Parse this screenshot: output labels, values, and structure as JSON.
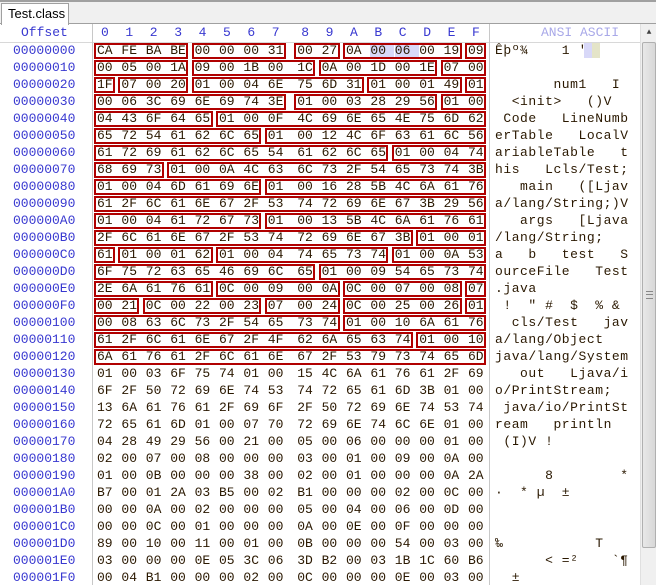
{
  "tab": {
    "label": "Test.class"
  },
  "header": {
    "offset_label": "Offset",
    "columns": [
      "0",
      "1",
      "2",
      "3",
      "4",
      "5",
      "6",
      "7",
      "8",
      "9",
      "A",
      "B",
      "C",
      "D",
      "E",
      "F"
    ],
    "ascii_label": "ANSI ASCII"
  },
  "selection": {
    "row": 0,
    "bytes": [
      11,
      12
    ]
  },
  "highlight_color": "#b00000",
  "rows": [
    {
      "offset": "00000000",
      "hex": [
        "CA",
        "FE",
        "BA",
        "BE",
        "00",
        "00",
        "00",
        "31",
        "00",
        "27",
        "0A",
        "00",
        "06",
        "00",
        "19",
        "09"
      ],
      "ascii": "Êþº¾    1 '     ",
      "groups": [
        [
          0,
          3
        ],
        [
          4,
          7
        ],
        [
          8,
          9
        ],
        [
          10,
          14
        ],
        [
          15,
          15
        ]
      ]
    },
    {
      "offset": "00000010",
      "hex": [
        "00",
        "05",
        "00",
        "1A",
        "09",
        "00",
        "1B",
        "00",
        "1C",
        "0A",
        "00",
        "1D",
        "00",
        "1E",
        "07",
        "00"
      ],
      "ascii": "                ",
      "groups": [
        [
          0,
          3
        ],
        [
          4,
          8
        ],
        [
          9,
          13
        ],
        [
          14,
          15
        ]
      ]
    },
    {
      "offset": "00000020",
      "hex": [
        "1F",
        "07",
        "00",
        "20",
        "01",
        "00",
        "04",
        "6E",
        "75",
        "6D",
        "31",
        "01",
        "00",
        "01",
        "49",
        "01"
      ],
      "ascii": "       num1   I ",
      "groups": [
        [
          0,
          0
        ],
        [
          1,
          3
        ],
        [
          4,
          10
        ],
        [
          11,
          14
        ],
        [
          15,
          15
        ]
      ]
    },
    {
      "offset": "00000030",
      "hex": [
        "00",
        "06",
        "3C",
        "69",
        "6E",
        "69",
        "74",
        "3E",
        "01",
        "00",
        "03",
        "28",
        "29",
        "56",
        "01",
        "00"
      ],
      "ascii": "  <init>   ()V  ",
      "groups": [
        [
          0,
          7
        ],
        [
          8,
          13
        ],
        [
          14,
          15
        ]
      ]
    },
    {
      "offset": "00000040",
      "hex": [
        "04",
        "43",
        "6F",
        "64",
        "65",
        "01",
        "00",
        "0F",
        "4C",
        "69",
        "6E",
        "65",
        "4E",
        "75",
        "6D",
        "62"
      ],
      "ascii": " Code   LineNumb",
      "groups": [
        [
          0,
          4
        ],
        [
          5,
          15
        ]
      ]
    },
    {
      "offset": "00000050",
      "hex": [
        "65",
        "72",
        "54",
        "61",
        "62",
        "6C",
        "65",
        "01",
        "00",
        "12",
        "4C",
        "6F",
        "63",
        "61",
        "6C",
        "56"
      ],
      "ascii": "erTable   LocalV",
      "groups": [
        [
          0,
          6
        ],
        [
          7,
          15
        ]
      ]
    },
    {
      "offset": "00000060",
      "hex": [
        "61",
        "72",
        "69",
        "61",
        "62",
        "6C",
        "65",
        "54",
        "61",
        "62",
        "6C",
        "65",
        "01",
        "00",
        "04",
        "74"
      ],
      "ascii": "ariableTable   t",
      "groups": [
        [
          0,
          11
        ],
        [
          12,
          15
        ]
      ]
    },
    {
      "offset": "00000070",
      "hex": [
        "68",
        "69",
        "73",
        "01",
        "00",
        "0A",
        "4C",
        "63",
        "6C",
        "73",
        "2F",
        "54",
        "65",
        "73",
        "74",
        "3B"
      ],
      "ascii": "his   Lcls/Test;",
      "groups": [
        [
          0,
          2
        ],
        [
          3,
          15
        ]
      ]
    },
    {
      "offset": "00000080",
      "hex": [
        "01",
        "00",
        "04",
        "6D",
        "61",
        "69",
        "6E",
        "01",
        "00",
        "16",
        "28",
        "5B",
        "4C",
        "6A",
        "61",
        "76"
      ],
      "ascii": "   main   ([Ljav",
      "groups": [
        [
          0,
          6
        ],
        [
          7,
          15
        ]
      ]
    },
    {
      "offset": "00000090",
      "hex": [
        "61",
        "2F",
        "6C",
        "61",
        "6E",
        "67",
        "2F",
        "53",
        "74",
        "72",
        "69",
        "6E",
        "67",
        "3B",
        "29",
        "56"
      ],
      "ascii": "a/lang/String;)V",
      "groups": [
        [
          0,
          15
        ]
      ]
    },
    {
      "offset": "000000A0",
      "hex": [
        "01",
        "00",
        "04",
        "61",
        "72",
        "67",
        "73",
        "01",
        "00",
        "13",
        "5B",
        "4C",
        "6A",
        "61",
        "76",
        "61"
      ],
      "ascii": "   args   [Ljava",
      "groups": [
        [
          0,
          6
        ],
        [
          7,
          15
        ]
      ]
    },
    {
      "offset": "000000B0",
      "hex": [
        "2F",
        "6C",
        "61",
        "6E",
        "67",
        "2F",
        "53",
        "74",
        "72",
        "69",
        "6E",
        "67",
        "3B",
        "01",
        "00",
        "01"
      ],
      "ascii": "/lang/String;   ",
      "groups": [
        [
          0,
          12
        ],
        [
          13,
          15
        ]
      ]
    },
    {
      "offset": "000000C0",
      "hex": [
        "61",
        "01",
        "00",
        "01",
        "62",
        "01",
        "00",
        "04",
        "74",
        "65",
        "73",
        "74",
        "01",
        "00",
        "0A",
        "53"
      ],
      "ascii": "a   b   test   S",
      "groups": [
        [
          0,
          0
        ],
        [
          1,
          4
        ],
        [
          5,
          11
        ],
        [
          12,
          15
        ]
      ]
    },
    {
      "offset": "000000D0",
      "hex": [
        "6F",
        "75",
        "72",
        "63",
        "65",
        "46",
        "69",
        "6C",
        "65",
        "01",
        "00",
        "09",
        "54",
        "65",
        "73",
        "74"
      ],
      "ascii": "ourceFile   Test",
      "groups": [
        [
          0,
          8
        ],
        [
          9,
          15
        ]
      ]
    },
    {
      "offset": "000000E0",
      "hex": [
        "2E",
        "6A",
        "61",
        "76",
        "61",
        "0C",
        "00",
        "09",
        "00",
        "0A",
        "0C",
        "00",
        "07",
        "00",
        "08",
        "07"
      ],
      "ascii": ".java           ",
      "groups": [
        [
          0,
          4
        ],
        [
          5,
          9
        ],
        [
          10,
          14
        ],
        [
          15,
          15
        ]
      ]
    },
    {
      "offset": "000000F0",
      "hex": [
        "00",
        "21",
        "0C",
        "00",
        "22",
        "00",
        "23",
        "07",
        "00",
        "24",
        "0C",
        "00",
        "25",
        "00",
        "26",
        "01"
      ],
      "ascii": " !  \" #  $  % & ",
      "groups": [
        [
          0,
          1
        ],
        [
          2,
          6
        ],
        [
          7,
          9
        ],
        [
          10,
          14
        ],
        [
          15,
          15
        ]
      ]
    },
    {
      "offset": "00000100",
      "hex": [
        "00",
        "08",
        "63",
        "6C",
        "73",
        "2F",
        "54",
        "65",
        "73",
        "74",
        "01",
        "00",
        "10",
        "6A",
        "61",
        "76"
      ],
      "ascii": "  cls/Test   jav",
      "groups": [
        [
          0,
          9
        ],
        [
          10,
          15
        ]
      ]
    },
    {
      "offset": "00000110",
      "hex": [
        "61",
        "2F",
        "6C",
        "61",
        "6E",
        "67",
        "2F",
        "4F",
        "62",
        "6A",
        "65",
        "63",
        "74",
        "01",
        "00",
        "10"
      ],
      "ascii": "a/lang/Object   ",
      "groups": [
        [
          0,
          12
        ],
        [
          13,
          15
        ]
      ]
    },
    {
      "offset": "00000120",
      "hex": [
        "6A",
        "61",
        "76",
        "61",
        "2F",
        "6C",
        "61",
        "6E",
        "67",
        "2F",
        "53",
        "79",
        "73",
        "74",
        "65",
        "6D"
      ],
      "ascii": "java/lang/System",
      "groups": [
        [
          0,
          15
        ]
      ]
    },
    {
      "offset": "00000130",
      "hex": [
        "01",
        "00",
        "03",
        "6F",
        "75",
        "74",
        "01",
        "00",
        "15",
        "4C",
        "6A",
        "61",
        "76",
        "61",
        "2F",
        "69"
      ],
      "ascii": "   out   Ljava/i",
      "groups": []
    },
    {
      "offset": "00000140",
      "hex": [
        "6F",
        "2F",
        "50",
        "72",
        "69",
        "6E",
        "74",
        "53",
        "74",
        "72",
        "65",
        "61",
        "6D",
        "3B",
        "01",
        "00"
      ],
      "ascii": "o/PrintStream;  ",
      "groups": []
    },
    {
      "offset": "00000150",
      "hex": [
        "13",
        "6A",
        "61",
        "76",
        "61",
        "2F",
        "69",
        "6F",
        "2F",
        "50",
        "72",
        "69",
        "6E",
        "74",
        "53",
        "74"
      ],
      "ascii": " java/io/PrintSt",
      "groups": []
    },
    {
      "offset": "00000160",
      "hex": [
        "72",
        "65",
        "61",
        "6D",
        "01",
        "00",
        "07",
        "70",
        "72",
        "69",
        "6E",
        "74",
        "6C",
        "6E",
        "01",
        "00"
      ],
      "ascii": "ream   println  ",
      "groups": []
    },
    {
      "offset": "00000170",
      "hex": [
        "04",
        "28",
        "49",
        "29",
        "56",
        "00",
        "21",
        "00",
        "05",
        "00",
        "06",
        "00",
        "00",
        "00",
        "01",
        "00"
      ],
      "ascii": " (I)V !         ",
      "groups": []
    },
    {
      "offset": "00000180",
      "hex": [
        "02",
        "00",
        "07",
        "00",
        "08",
        "00",
        "00",
        "00",
        "03",
        "00",
        "01",
        "00",
        "09",
        "00",
        "0A",
        "00"
      ],
      "ascii": "                ",
      "groups": []
    },
    {
      "offset": "00000190",
      "hex": [
        "01",
        "00",
        "0B",
        "00",
        "00",
        "00",
        "38",
        "00",
        "02",
        "00",
        "01",
        "00",
        "00",
        "00",
        "0A",
        "2A"
      ],
      "ascii": "      8        *",
      "groups": []
    },
    {
      "offset": "000001A0",
      "hex": [
        "B7",
        "00",
        "01",
        "2A",
        "03",
        "B5",
        "00",
        "02",
        "B1",
        "00",
        "00",
        "00",
        "02",
        "00",
        "0C",
        "00"
      ],
      "ascii": "·  * µ  ±       ",
      "groups": []
    },
    {
      "offset": "000001B0",
      "hex": [
        "00",
        "00",
        "0A",
        "00",
        "02",
        "00",
        "00",
        "00",
        "05",
        "00",
        "04",
        "00",
        "06",
        "00",
        "0D",
        "00"
      ],
      "ascii": "                ",
      "groups": []
    },
    {
      "offset": "000001C0",
      "hex": [
        "00",
        "00",
        "0C",
        "00",
        "01",
        "00",
        "00",
        "00",
        "0A",
        "00",
        "0E",
        "00",
        "0F",
        "00",
        "00",
        "00"
      ],
      "ascii": "                ",
      "groups": []
    },
    {
      "offset": "000001D0",
      "hex": [
        "89",
        "00",
        "10",
        "00",
        "11",
        "00",
        "01",
        "00",
        "0B",
        "00",
        "00",
        "00",
        "54",
        "00",
        "03",
        "00"
      ],
      "ascii": "‰           T   ",
      "groups": []
    },
    {
      "offset": "000001E0",
      "hex": [
        "03",
        "00",
        "00",
        "00",
        "0E",
        "05",
        "3C",
        "06",
        "3D",
        "B2",
        "00",
        "03",
        "1B",
        "1C",
        "60",
        "B6"
      ],
      "ascii": "      < =²    `¶",
      "groups": []
    },
    {
      "offset": "000001F0",
      "hex": [
        "00",
        "04",
        "B1",
        "00",
        "00",
        "00",
        "02",
        "00",
        "0C",
        "00",
        "00",
        "00",
        "0E",
        "00",
        "03",
        "00"
      ],
      "ascii": "  ±             ",
      "groups": []
    }
  ]
}
